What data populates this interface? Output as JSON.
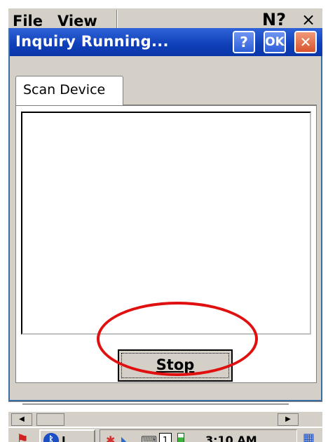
{
  "background_app": {
    "menu": [
      "File",
      "View"
    ],
    "help_glyph": "N?",
    "close_glyph": "×"
  },
  "dialog": {
    "title": "Inquiry Running...",
    "buttons": {
      "help": "?",
      "ok": "OK",
      "close": "✕"
    },
    "tab_label": "Scan Device",
    "stop_label": "Stop"
  },
  "scrollbar": {
    "left_arrow": "◀",
    "right_arrow": "▶"
  },
  "taskbar": {
    "start_icon": "windows-flag-icon",
    "app_label": "I...",
    "tray_num": "1",
    "time": "3:10 AM"
  },
  "colors": {
    "titlebar": "#0f3fb8",
    "annotation": "#e01010",
    "close_button": "#d9532d"
  }
}
